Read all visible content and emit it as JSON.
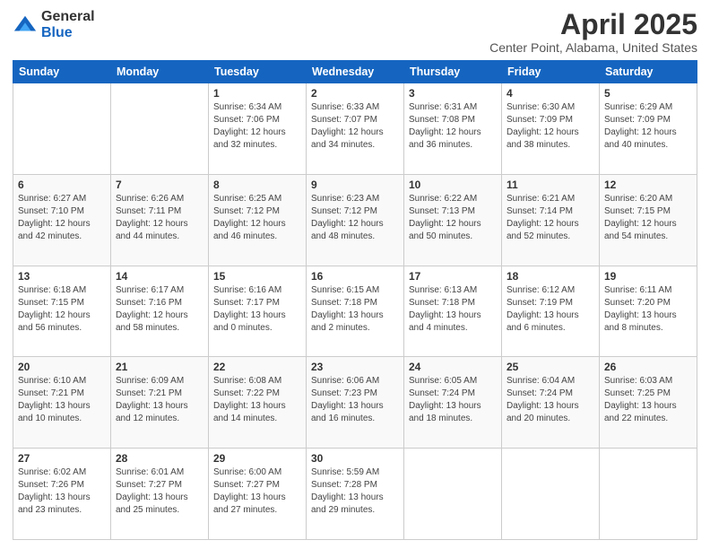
{
  "logo": {
    "general": "General",
    "blue": "Blue"
  },
  "header": {
    "title": "April 2025",
    "subtitle": "Center Point, Alabama, United States"
  },
  "days_of_week": [
    "Sunday",
    "Monday",
    "Tuesday",
    "Wednesday",
    "Thursday",
    "Friday",
    "Saturday"
  ],
  "weeks": [
    [
      {
        "day": "",
        "info": ""
      },
      {
        "day": "",
        "info": ""
      },
      {
        "day": "1",
        "info": "Sunrise: 6:34 AM\nSunset: 7:06 PM\nDaylight: 12 hours and 32 minutes."
      },
      {
        "day": "2",
        "info": "Sunrise: 6:33 AM\nSunset: 7:07 PM\nDaylight: 12 hours and 34 minutes."
      },
      {
        "day": "3",
        "info": "Sunrise: 6:31 AM\nSunset: 7:08 PM\nDaylight: 12 hours and 36 minutes."
      },
      {
        "day": "4",
        "info": "Sunrise: 6:30 AM\nSunset: 7:09 PM\nDaylight: 12 hours and 38 minutes."
      },
      {
        "day": "5",
        "info": "Sunrise: 6:29 AM\nSunset: 7:09 PM\nDaylight: 12 hours and 40 minutes."
      }
    ],
    [
      {
        "day": "6",
        "info": "Sunrise: 6:27 AM\nSunset: 7:10 PM\nDaylight: 12 hours and 42 minutes."
      },
      {
        "day": "7",
        "info": "Sunrise: 6:26 AM\nSunset: 7:11 PM\nDaylight: 12 hours and 44 minutes."
      },
      {
        "day": "8",
        "info": "Sunrise: 6:25 AM\nSunset: 7:12 PM\nDaylight: 12 hours and 46 minutes."
      },
      {
        "day": "9",
        "info": "Sunrise: 6:23 AM\nSunset: 7:12 PM\nDaylight: 12 hours and 48 minutes."
      },
      {
        "day": "10",
        "info": "Sunrise: 6:22 AM\nSunset: 7:13 PM\nDaylight: 12 hours and 50 minutes."
      },
      {
        "day": "11",
        "info": "Sunrise: 6:21 AM\nSunset: 7:14 PM\nDaylight: 12 hours and 52 minutes."
      },
      {
        "day": "12",
        "info": "Sunrise: 6:20 AM\nSunset: 7:15 PM\nDaylight: 12 hours and 54 minutes."
      }
    ],
    [
      {
        "day": "13",
        "info": "Sunrise: 6:18 AM\nSunset: 7:15 PM\nDaylight: 12 hours and 56 minutes."
      },
      {
        "day": "14",
        "info": "Sunrise: 6:17 AM\nSunset: 7:16 PM\nDaylight: 12 hours and 58 minutes."
      },
      {
        "day": "15",
        "info": "Sunrise: 6:16 AM\nSunset: 7:17 PM\nDaylight: 13 hours and 0 minutes."
      },
      {
        "day": "16",
        "info": "Sunrise: 6:15 AM\nSunset: 7:18 PM\nDaylight: 13 hours and 2 minutes."
      },
      {
        "day": "17",
        "info": "Sunrise: 6:13 AM\nSunset: 7:18 PM\nDaylight: 13 hours and 4 minutes."
      },
      {
        "day": "18",
        "info": "Sunrise: 6:12 AM\nSunset: 7:19 PM\nDaylight: 13 hours and 6 minutes."
      },
      {
        "day": "19",
        "info": "Sunrise: 6:11 AM\nSunset: 7:20 PM\nDaylight: 13 hours and 8 minutes."
      }
    ],
    [
      {
        "day": "20",
        "info": "Sunrise: 6:10 AM\nSunset: 7:21 PM\nDaylight: 13 hours and 10 minutes."
      },
      {
        "day": "21",
        "info": "Sunrise: 6:09 AM\nSunset: 7:21 PM\nDaylight: 13 hours and 12 minutes."
      },
      {
        "day": "22",
        "info": "Sunrise: 6:08 AM\nSunset: 7:22 PM\nDaylight: 13 hours and 14 minutes."
      },
      {
        "day": "23",
        "info": "Sunrise: 6:06 AM\nSunset: 7:23 PM\nDaylight: 13 hours and 16 minutes."
      },
      {
        "day": "24",
        "info": "Sunrise: 6:05 AM\nSunset: 7:24 PM\nDaylight: 13 hours and 18 minutes."
      },
      {
        "day": "25",
        "info": "Sunrise: 6:04 AM\nSunset: 7:24 PM\nDaylight: 13 hours and 20 minutes."
      },
      {
        "day": "26",
        "info": "Sunrise: 6:03 AM\nSunset: 7:25 PM\nDaylight: 13 hours and 22 minutes."
      }
    ],
    [
      {
        "day": "27",
        "info": "Sunrise: 6:02 AM\nSunset: 7:26 PM\nDaylight: 13 hours and 23 minutes."
      },
      {
        "day": "28",
        "info": "Sunrise: 6:01 AM\nSunset: 7:27 PM\nDaylight: 13 hours and 25 minutes."
      },
      {
        "day": "29",
        "info": "Sunrise: 6:00 AM\nSunset: 7:27 PM\nDaylight: 13 hours and 27 minutes."
      },
      {
        "day": "30",
        "info": "Sunrise: 5:59 AM\nSunset: 7:28 PM\nDaylight: 13 hours and 29 minutes."
      },
      {
        "day": "",
        "info": ""
      },
      {
        "day": "",
        "info": ""
      },
      {
        "day": "",
        "info": ""
      }
    ]
  ]
}
